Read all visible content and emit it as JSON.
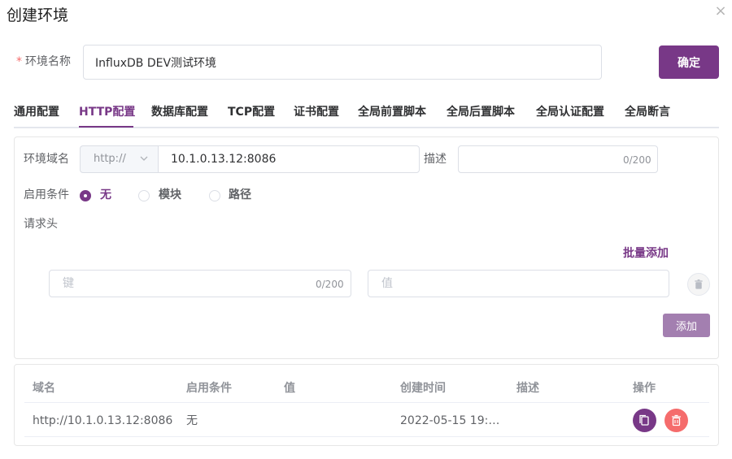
{
  "dialog": {
    "title": "创建环境",
    "close_glyph": "×"
  },
  "env_name": {
    "required_mark": "*",
    "label": "环境名称",
    "value": "InfluxDB DEV测试环境"
  },
  "confirm_label": "确定",
  "tabs": [
    {
      "label": "通用配置",
      "active": false
    },
    {
      "label": "HTTP配置",
      "active": true
    },
    {
      "label": "数据库配置",
      "active": false
    },
    {
      "label": "TCP配置",
      "active": false
    },
    {
      "label": "证书配置",
      "active": false
    },
    {
      "label": "全局前置脚本",
      "active": false
    },
    {
      "label": "全局后置脚本",
      "active": false
    },
    {
      "label": "全局认证配置",
      "active": false
    },
    {
      "label": "全局断言",
      "active": false
    }
  ],
  "http": {
    "domain_label": "环境域名",
    "protocol": "http://",
    "domain_value": "10.1.0.13.12:8086",
    "desc_label": "描述",
    "desc_counter": "0/200",
    "condition_label": "启用条件",
    "conditions": [
      {
        "label": "无",
        "checked": true
      },
      {
        "label": "模块",
        "checked": false
      },
      {
        "label": "路径",
        "checked": false
      }
    ],
    "headers_label": "请求头",
    "batch_add": "批量添加",
    "key_placeholder": "键",
    "key_counter": "0/200",
    "value_placeholder": "值",
    "add_label": "添加"
  },
  "table": {
    "columns": [
      "域名",
      "启用条件",
      "值",
      "创建时间",
      "描述",
      "操作"
    ],
    "rows": [
      {
        "domain": "http://10.1.0.13.12:8086",
        "condition": "无",
        "value": "",
        "created": "2022-05-15 19:…",
        "desc": ""
      }
    ]
  },
  "colors": {
    "accent": "#783887",
    "danger": "#f56c6c",
    "add_button": "#a37fb0"
  }
}
